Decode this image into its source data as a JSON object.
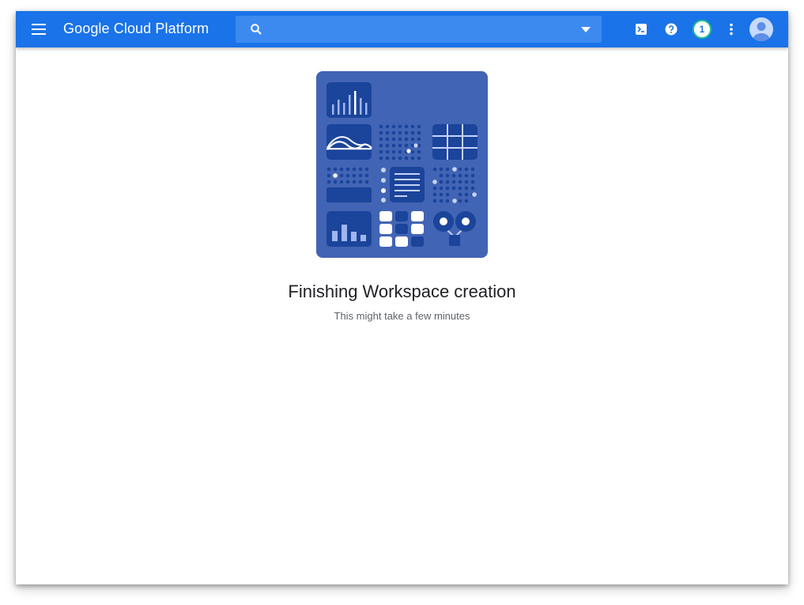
{
  "header": {
    "brand": "Google Cloud Platform",
    "search": {
      "placeholder": "",
      "value": ""
    },
    "notification_count": "1",
    "icons": [
      "menu-icon",
      "search-icon",
      "dropdown-arrow-icon",
      "cloud-shell-icon",
      "help-icon",
      "more-vert-icon",
      "account-avatar"
    ]
  },
  "main": {
    "title": "Finishing Workspace creation",
    "subtitle": "This might take a few minutes"
  },
  "colors": {
    "topbar": "#1a73e8",
    "search_bg": "#3c8af0",
    "illustration_bg": "#4264b4",
    "badge_ring": "#1ec28b"
  }
}
